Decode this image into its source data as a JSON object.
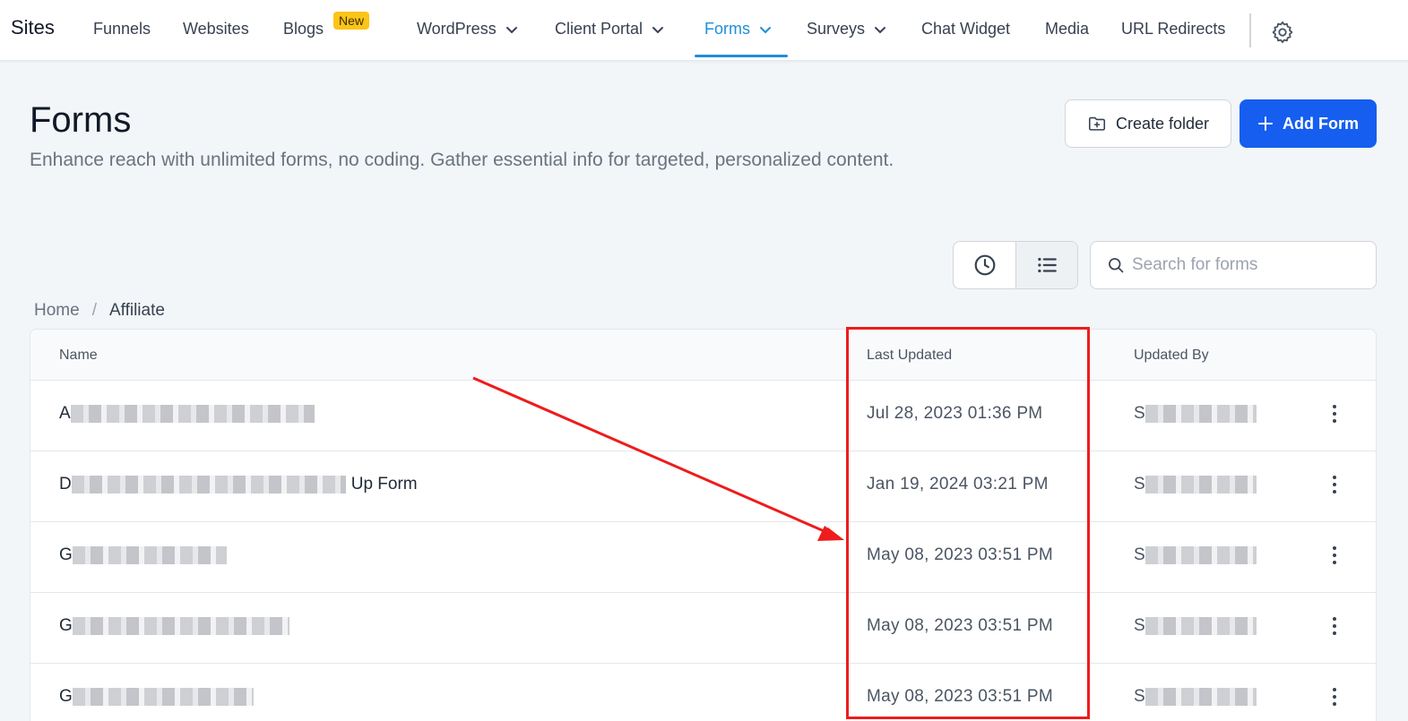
{
  "nav": {
    "brand": "Sites",
    "items": [
      {
        "label": "Funnels"
      },
      {
        "label": "Websites"
      },
      {
        "label": "Blogs",
        "badge": "New"
      },
      {
        "label": "WordPress",
        "dropdown": true
      },
      {
        "label": "Client Portal",
        "dropdown": true
      },
      {
        "label": "Forms",
        "dropdown": true,
        "active": true
      },
      {
        "label": "Surveys",
        "dropdown": true
      },
      {
        "label": "Chat Widget"
      },
      {
        "label": "Media"
      },
      {
        "label": "URL Redirects"
      }
    ],
    "settings_icon": "gear-icon"
  },
  "header": {
    "title": "Forms",
    "description": "Enhance reach with unlimited forms, no coding. Gather essential info for targeted, personalized content.",
    "create_folder_label": "Create folder",
    "add_form_label": "Add Form"
  },
  "search": {
    "placeholder": "Search for forms"
  },
  "breadcrumb": {
    "home": "Home",
    "separator": "/",
    "current": "Affiliate"
  },
  "table": {
    "columns": {
      "name": "Name",
      "last_updated": "Last Updated",
      "updated_by": "Updated By"
    },
    "rows": [
      {
        "name_prefix": "A",
        "name_suffix": "",
        "last_updated": "Jul 28, 2023 01:36 PM",
        "updated_by_prefix": "S"
      },
      {
        "name_prefix": "D",
        "name_suffix": "Up Form",
        "last_updated": "Jan 19, 2024 03:21 PM",
        "updated_by_prefix": "S"
      },
      {
        "name_prefix": "G",
        "name_suffix": "",
        "last_updated": "May 08, 2023 03:51 PM",
        "updated_by_prefix": "S"
      },
      {
        "name_prefix": "G",
        "name_suffix": "",
        "last_updated": "May 08, 2023 03:51 PM",
        "updated_by_prefix": "S"
      },
      {
        "name_prefix": "G",
        "name_suffix": "",
        "last_updated": "May 08, 2023 03:51 PM",
        "updated_by_prefix": "S"
      }
    ]
  },
  "colors": {
    "accent": "#1d8fd8",
    "primary_button": "#155eef",
    "badge": "#fcc419",
    "annotation": "#ee1c1c"
  }
}
